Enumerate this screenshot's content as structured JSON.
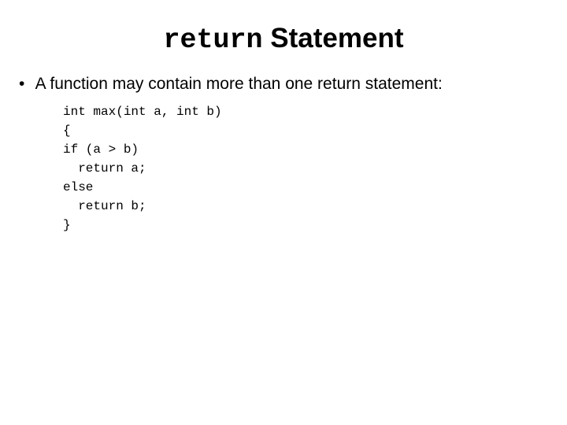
{
  "title": {
    "keyword": "return",
    "rest": " Statement"
  },
  "bullet": {
    "marker": "•",
    "text": " A function may contain more than one return statement:"
  },
  "code": {
    "line1": "int max(int a, int b)",
    "line2": "{",
    "line3": "if (a > b)",
    "line4": "  return a;",
    "line5": "else",
    "line6": "  return b;",
    "line7": "}"
  }
}
